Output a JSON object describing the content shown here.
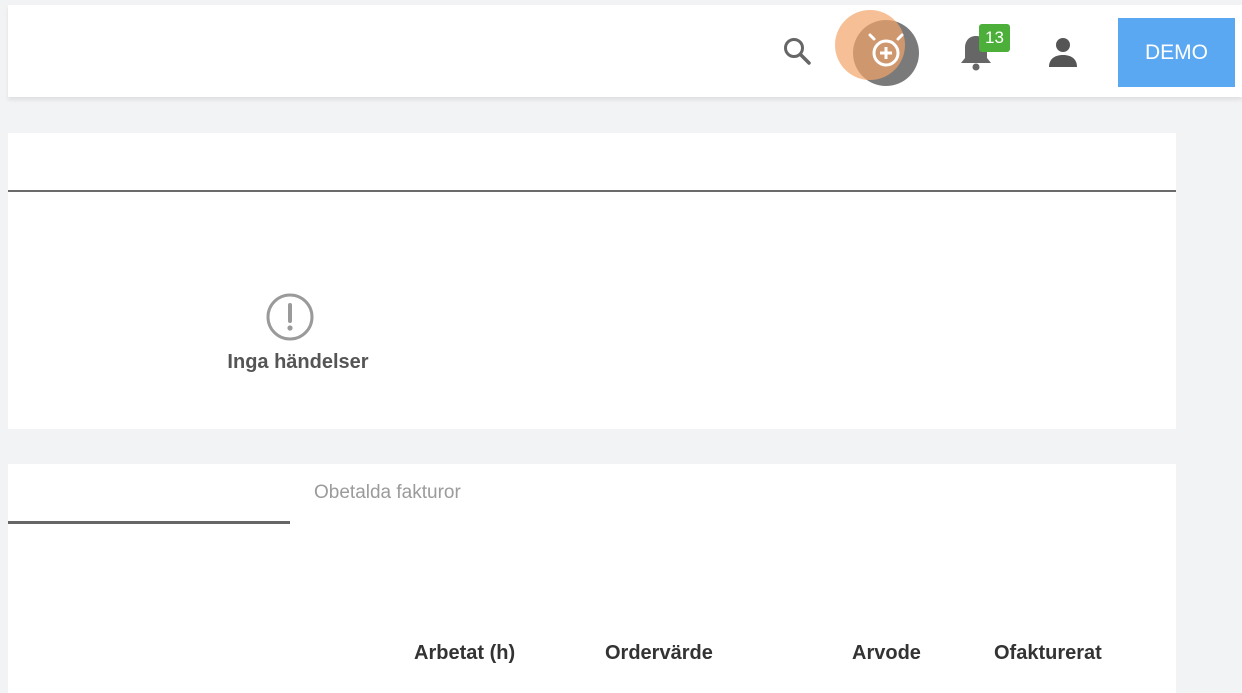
{
  "topbar": {
    "notification_count": "13",
    "demo_label": "DEMO",
    "icons": {
      "search": "search-icon",
      "timer": "alarm-add-icon",
      "notifications": "bell-icon",
      "profile": "user-icon"
    },
    "colors": {
      "badge": "#4caf3a",
      "demo_button": "#5aa7f2",
      "timer_highlight": "#f4a46a"
    }
  },
  "events_card": {
    "empty_icon": "exclamation-circle-icon",
    "empty_text": "Inga händelser"
  },
  "table_card": {
    "tabs": [
      {
        "label": "",
        "active": true
      },
      {
        "label": "Obetalda fakturor",
        "active": false
      }
    ],
    "columns": [
      "Arbetat (h)",
      "Ordervärde",
      "Arvode",
      "Ofakturerat"
    ]
  }
}
